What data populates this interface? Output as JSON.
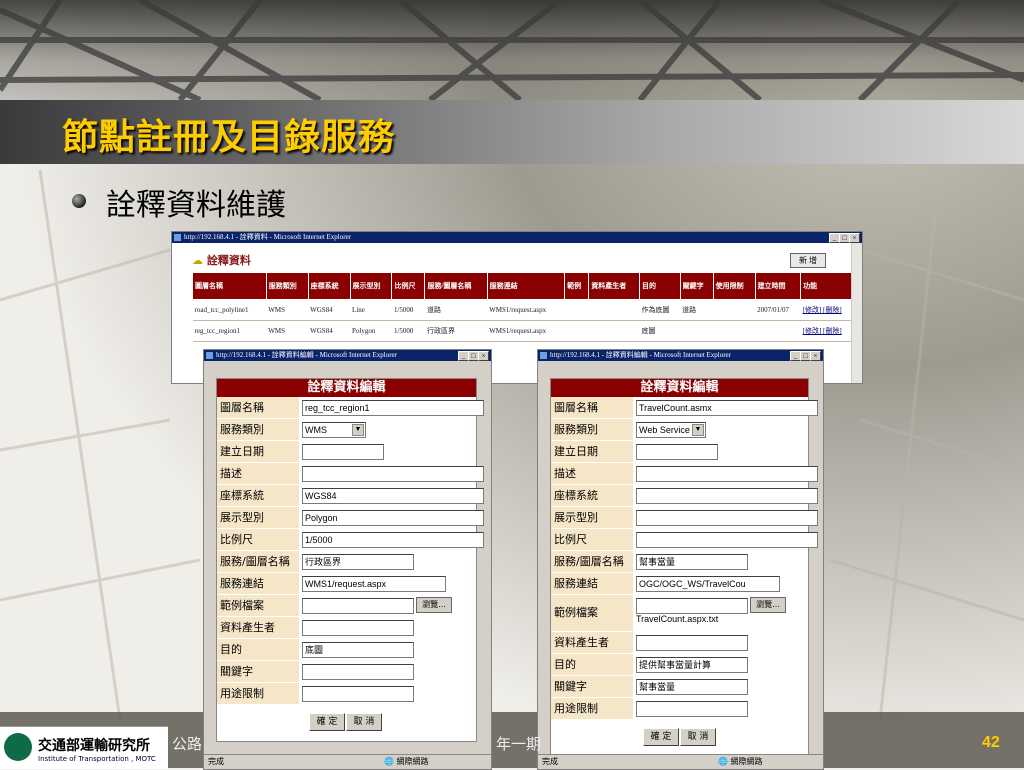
{
  "slide": {
    "title": "節點註冊及目錄服務",
    "bullet": "詮釋資料維護",
    "page_number": "42",
    "footer_left": "公路",
    "footer_right": "年一期"
  },
  "org": {
    "name": "交通部運輸研究所",
    "name_en": "Institute of Transportation , MOTC"
  },
  "main_window": {
    "title": "http://192.168.4.1 - 詮釋資料 - Microsoft Internet Explorer",
    "heading": "詮釋資料",
    "add_button": "新 增",
    "columns": [
      "圖層名稱",
      "服務類別",
      "座標系統",
      "展示型別",
      "比例尺",
      "服務/圖層名稱",
      "服務連結",
      "範例",
      "資料產生者",
      "目的",
      "關鍵字",
      "使用限制",
      "建立時間",
      "功能"
    ],
    "rows": [
      [
        "road_tcc_polyline1",
        "WMS",
        "WGS84",
        "Line",
        "1/5000",
        "道路",
        "WMS1/request.aspx",
        "",
        "",
        "作為底圖",
        "道路",
        "",
        "2007/01/07",
        "[修改] [刪除]"
      ],
      [
        "reg_tcc_region1",
        "WMS",
        "WGS84",
        "Polygon",
        "1/5000",
        "行政區界",
        "WMS1/request.aspx",
        "",
        "",
        "底圖",
        "",
        "",
        "",
        "[修改] [刪除]"
      ]
    ]
  },
  "dialog_left": {
    "title": "http://192.168.4.1 - 詮釋資料編輯 - Microsoft Internet Explorer",
    "heading": "詮釋資料編輯",
    "fields": [
      {
        "label": "圖層名稱",
        "value": "reg_tcc_region1"
      },
      {
        "label": "服務類別",
        "value": "WMS"
      },
      {
        "label": "建立日期",
        "value": ""
      },
      {
        "label": "描述",
        "value": ""
      },
      {
        "label": "座標系統",
        "value": "WGS84"
      },
      {
        "label": "展示型別",
        "value": "Polygon"
      },
      {
        "label": "比例尺",
        "value": "1/5000"
      },
      {
        "label": "服務/圖層名稱",
        "value": "行政區界"
      },
      {
        "label": "服務連結",
        "value": "WMS1/request.aspx"
      },
      {
        "label": "範例檔案",
        "value": ""
      },
      {
        "label": "資料產生者",
        "value": ""
      },
      {
        "label": "目的",
        "value": "底圖"
      },
      {
        "label": "關鍵字",
        "value": ""
      },
      {
        "label": "用途限制",
        "value": ""
      }
    ],
    "browse": "瀏覽...",
    "ok": "確 定",
    "cancel": "取 消",
    "status_left": "完成",
    "status_right": "網際網路"
  },
  "dialog_right": {
    "title": "http://192.168.4.1 - 詮釋資料編輯 - Microsoft Internet Explorer",
    "heading": "詮釋資料編輯",
    "fields": [
      {
        "label": "圖層名稱",
        "value": "TravelCount.asmx"
      },
      {
        "label": "服務類別",
        "value": "Web Service"
      },
      {
        "label": "建立日期",
        "value": ""
      },
      {
        "label": "描述",
        "value": ""
      },
      {
        "label": "座標系統",
        "value": ""
      },
      {
        "label": "展示型別",
        "value": ""
      },
      {
        "label": "比例尺",
        "value": ""
      },
      {
        "label": "服務/圖層名稱",
        "value": "幫事當量"
      },
      {
        "label": "服務連結",
        "value": "OGC/OGC_WS/TravelCou"
      },
      {
        "label": "範例檔案",
        "value": "",
        "note": "TravelCount.aspx.txt"
      },
      {
        "label": "資料產生者",
        "value": ""
      },
      {
        "label": "目的",
        "value": "提供幫事當量計算"
      },
      {
        "label": "關鍵字",
        "value": "幫事當量"
      },
      {
        "label": "用途限制",
        "value": ""
      }
    ],
    "browse": "瀏覽...",
    "ok": "確 定",
    "cancel": "取 消",
    "status_left": "完成",
    "status_right": "網際網路"
  },
  "colors": {
    "title": "#ffcc00",
    "header_bg": "#8b0000",
    "label_bg": "#f5e6c8"
  }
}
